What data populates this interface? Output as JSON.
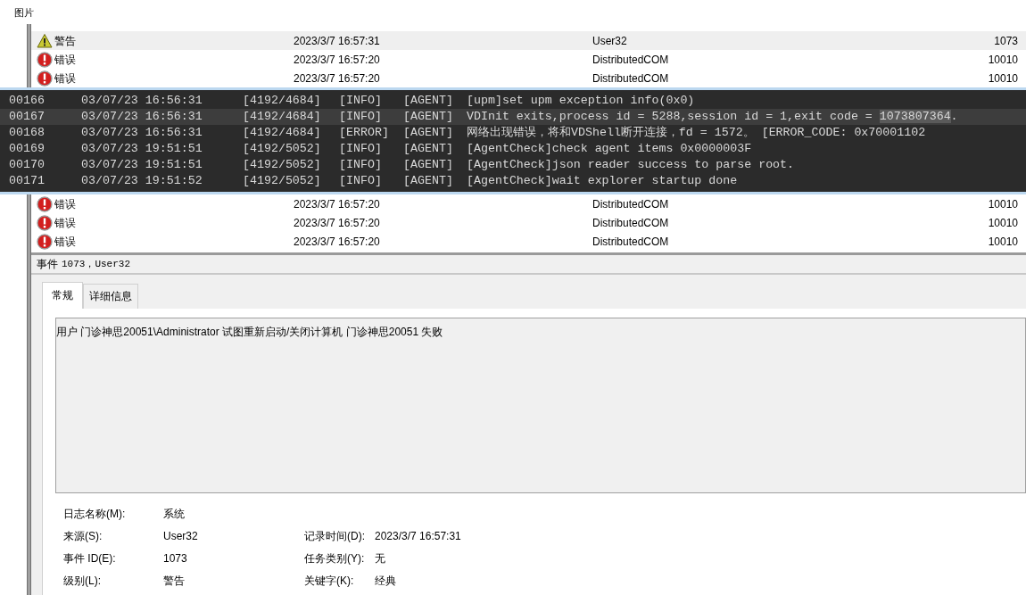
{
  "window": {
    "title": "图片"
  },
  "events_top": [
    {
      "kind": "warning",
      "level": "警告",
      "date": "2023/3/7 16:57:31",
      "source": "User32",
      "event_id": "1073",
      "selected": true
    },
    {
      "kind": "error",
      "level": "错误",
      "date": "2023/3/7 16:57:20",
      "source": "DistributedCOM",
      "event_id": "10010",
      "selected": false
    },
    {
      "kind": "error",
      "level": "错误",
      "date": "2023/3/7 16:57:20",
      "source": "DistributedCOM",
      "event_id": "10010",
      "selected": false
    }
  ],
  "log_overlay": {
    "lines": [
      {
        "no": "00166",
        "time": "03/07/23 16:56:31",
        "thread": "[4192/4684]",
        "level": "[INFO]",
        "module": "[AGENT]",
        "message": "[upm]set upm exception info(0x0)",
        "selected": false
      },
      {
        "no": "00167",
        "time": "03/07/23 16:56:31",
        "thread": "[4192/4684]",
        "level": "[INFO]",
        "module": "[AGENT]",
        "message": "VDInit exits,process id = 5288,session id = 1,exit code = ",
        "highlight": "1073807364",
        "after": ".",
        "selected": true
      },
      {
        "no": "00168",
        "time": "03/07/23 16:56:31",
        "thread": "[4192/4684]",
        "level": "[ERROR]",
        "module": "[AGENT]",
        "message": "网络出现错误，将和VDShell断开连接，fd = 1572。 [ERROR_CODE: 0x70001102",
        "selected": false
      },
      {
        "no": "00169",
        "time": "03/07/23 19:51:51",
        "thread": "[4192/5052]",
        "level": "[INFO]",
        "module": "[AGENT]",
        "message": "[AgentCheck]check agent items 0x0000003F",
        "selected": false
      },
      {
        "no": "00170",
        "time": "03/07/23 19:51:51",
        "thread": "[4192/5052]",
        "level": "[INFO]",
        "module": "[AGENT]",
        "message": "[AgentCheck]json reader success to parse root.",
        "selected": false
      },
      {
        "no": "00171",
        "time": "03/07/23 19:51:52",
        "thread": "[4192/5052]",
        "level": "[INFO]",
        "module": "[AGENT]",
        "message": "[AgentCheck]wait explorer startup done",
        "selected": false
      }
    ]
  },
  "events_bottom": [
    {
      "kind": "error",
      "level": "错误",
      "date": "2023/3/7 16:57:20",
      "source": "DistributedCOM",
      "event_id": "10010",
      "selected": false
    },
    {
      "kind": "error",
      "level": "错误",
      "date": "2023/3/7 16:57:20",
      "source": "DistributedCOM",
      "event_id": "10010",
      "selected": false
    },
    {
      "kind": "error",
      "level": "错误",
      "date": "2023/3/7 16:57:20",
      "source": "DistributedCOM",
      "event_id": "10010",
      "selected": false
    }
  ],
  "details": {
    "header_label": "事件",
    "header_value": "1073，User32",
    "tabs": [
      {
        "label": "常规",
        "selected": true
      },
      {
        "label": "详细信息",
        "selected": false
      }
    ],
    "message": "用户 门诊神思20051\\Administrator 试图重新启动/关闭计算机 门诊神思20051 失败",
    "fields": [
      {
        "label": "日志名称(M):",
        "value": "系统"
      },
      {
        "label": "来源(S):",
        "value": "User32",
        "label2": "记录时间(D):",
        "value2": "2023/3/7 16:57:31"
      },
      {
        "label": "事件 ID(E):",
        "value": "1073",
        "label2": "任务类别(Y):",
        "value2": "无"
      },
      {
        "label": "级别(L):",
        "value": "警告",
        "label2": "关键字(K):",
        "value2": "经典"
      }
    ]
  }
}
